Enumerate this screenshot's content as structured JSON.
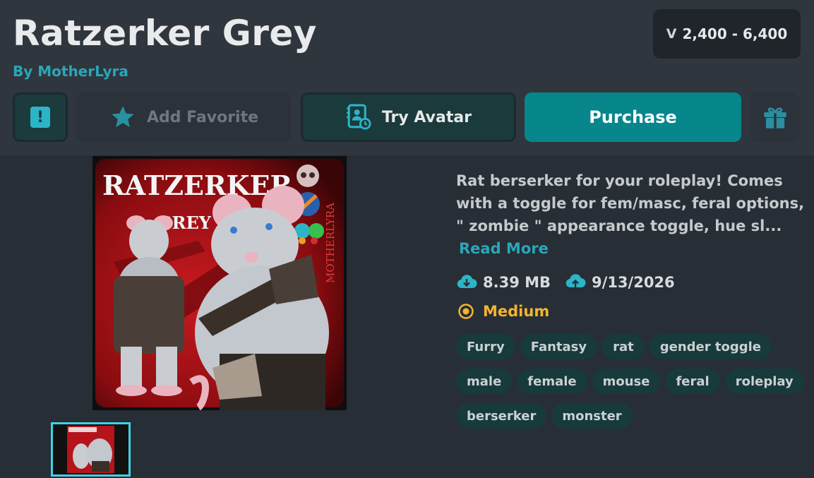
{
  "header": {
    "title": "Ratzerker Grey",
    "author": "By MotherLyra",
    "price_symbol": "V",
    "price_range": "2,400 - 6,400"
  },
  "actions": {
    "report_icon": "exclamation-icon",
    "favorite_label": "Add Favorite",
    "try_label": "Try Avatar",
    "purchase_label": "Purchase",
    "gift_icon": "gift-icon"
  },
  "image": {
    "art_title": "RATZERKER",
    "art_subtitle": "GREY",
    "art_watermark": "MOTHERLYRA"
  },
  "details": {
    "description": "Rat berserker for your roleplay! Comes with a toggle for fem/masc, feral options,  \" zombie \"  appearance toggle, hue sl...",
    "read_more": "Read More",
    "file_size": "8.39 MB",
    "upload_date": "9/13/2026",
    "performance": "Medium"
  },
  "tags": [
    "Furry",
    "Fantasy",
    "rat",
    "gender toggle",
    "male",
    "female",
    "mouse",
    "feral",
    "roleplay",
    "berserker",
    "monster"
  ],
  "colors": {
    "accent": "#07868c",
    "link": "#2aa6b8",
    "performance": "#f2b530"
  }
}
